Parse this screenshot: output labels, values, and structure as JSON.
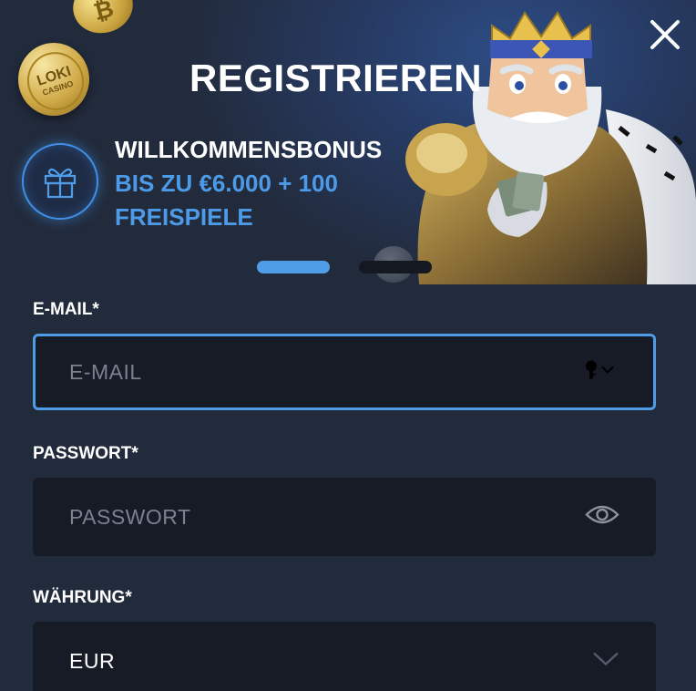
{
  "header": {
    "title": "REGISTRIEREN",
    "close_icon": "close-icon"
  },
  "promo": {
    "line1": "WILLKOMMENSBONUS",
    "line2": "BIS ZU €6.000 + 100",
    "line3": "FREISPIELE",
    "icon": "gift-icon",
    "coin_text_1": "LOKI",
    "coin_text_2": "CASINO",
    "coin_symbol": "₿"
  },
  "carousel": {
    "slides": 2,
    "active": 1
  },
  "form": {
    "email": {
      "label": "E-MAIL*",
      "placeholder": "E-MAIL",
      "value": "",
      "icon": "key-icon"
    },
    "password": {
      "label": "PASSWORT*",
      "placeholder": "PASSWORT",
      "value": "",
      "icon": "eye-icon"
    },
    "currency": {
      "label": "WÄHRUNG*",
      "value": "EUR",
      "icon": "chevron-down-icon"
    }
  },
  "colors": {
    "background": "#222b3c",
    "field": "#161b26",
    "accent": "#4f9de6",
    "placeholder": "#7b8190"
  }
}
